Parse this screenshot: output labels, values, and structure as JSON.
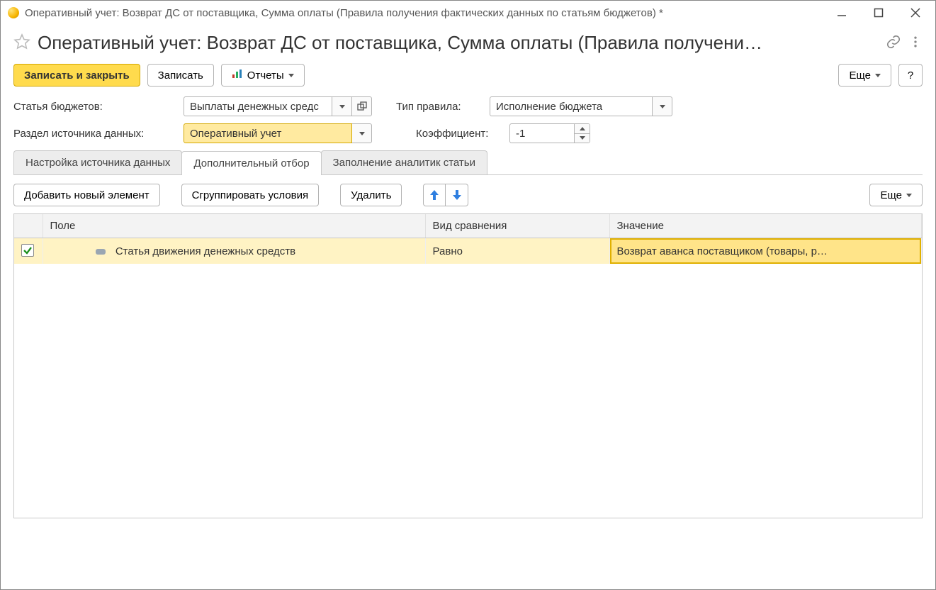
{
  "window": {
    "title": "Оперативный учет: Возврат ДС от поставщика, Сумма оплаты (Правила получения фактических данных по статьям бюджетов) *"
  },
  "header": {
    "title": "Оперативный учет: Возврат ДС от поставщика, Сумма оплаты (Правила получени…"
  },
  "toolbar": {
    "save_close": "Записать и закрыть",
    "save": "Записать",
    "reports": "Отчеты",
    "more": "Еще",
    "help": "?"
  },
  "form": {
    "budget_item_label": "Статья бюджетов:",
    "budget_item_value": "Выплаты денежных средс",
    "rule_type_label": "Тип правила:",
    "rule_type_value": "Исполнение бюджета",
    "datasource_section_label": "Раздел источника данных:",
    "datasource_section_value": "Оперативный учет",
    "coefficient_label": "Коэффициент:",
    "coefficient_value": "-1"
  },
  "tabs": {
    "t0": "Настройка источника данных",
    "t1": "Дополнительный отбор",
    "t2": "Заполнение аналитик статьи"
  },
  "filter_toolbar": {
    "add_element": "Добавить новый элемент",
    "group_conditions": "Сгруппировать условия",
    "delete": "Удалить",
    "more": "Еще"
  },
  "table": {
    "headers": {
      "field": "Поле",
      "comparison": "Вид сравнения",
      "value": "Значение"
    },
    "rows": [
      {
        "checked": true,
        "field": "Статья движения денежных средств",
        "comparison": "Равно",
        "value": "Возврат аванса поставщиком (товары, р…"
      }
    ]
  }
}
